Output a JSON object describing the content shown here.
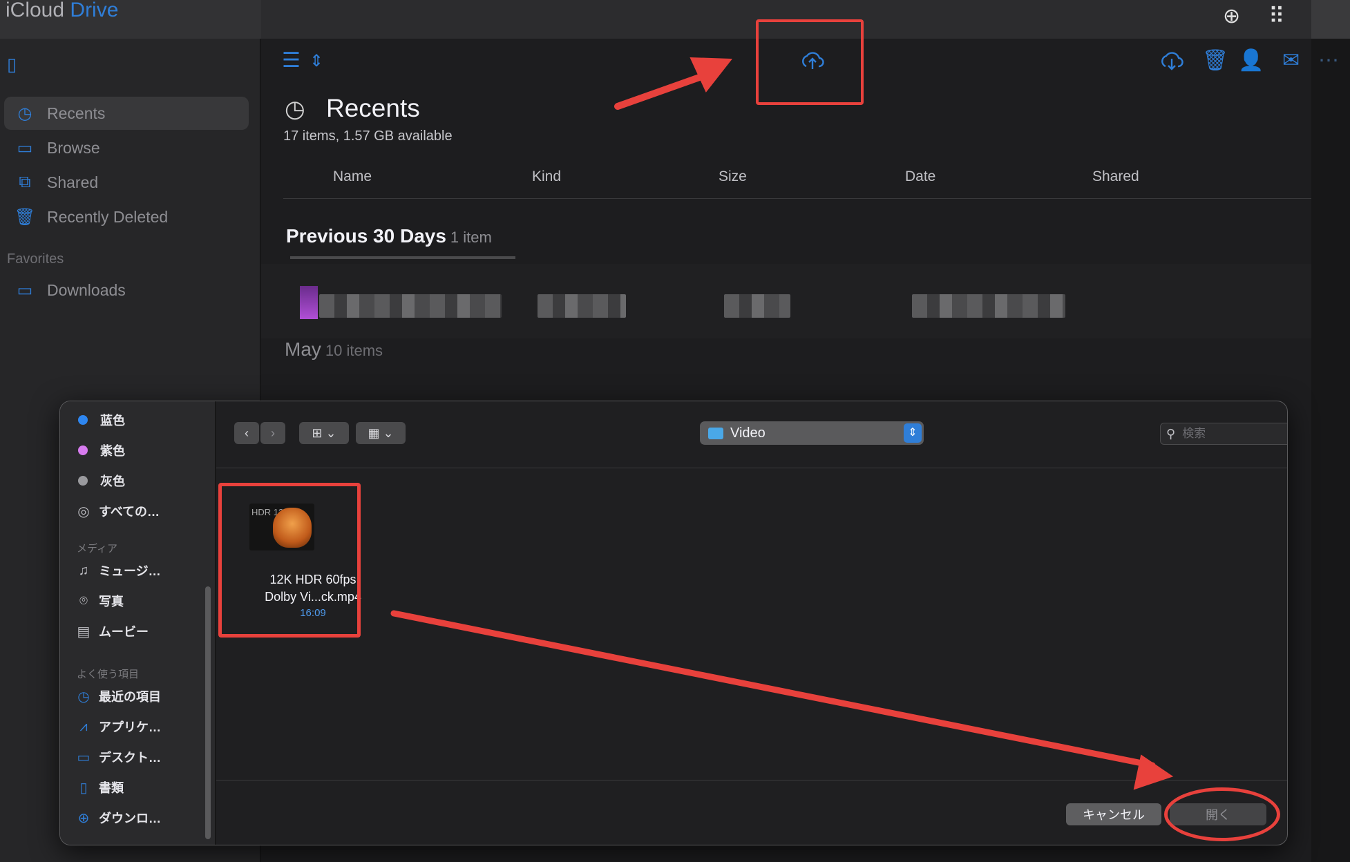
{
  "app": {
    "title_part1": "iCloud",
    "title_part2": "Drive"
  },
  "sidebar": {
    "items": [
      {
        "label": "Recents",
        "icon": "clock-icon"
      },
      {
        "label": "Browse",
        "icon": "folder-icon"
      },
      {
        "label": "Shared",
        "icon": "shared-folder-icon"
      },
      {
        "label": "Recently Deleted",
        "icon": "trash-icon"
      }
    ],
    "favorites_heading": "Favorites",
    "favorites": [
      {
        "label": "Downloads",
        "icon": "folder-icon"
      }
    ]
  },
  "main": {
    "title": "Recents",
    "subtitle": "17 items, 1.57 GB available",
    "columns": [
      "Name",
      "Kind",
      "Size",
      "Date",
      "Shared"
    ],
    "sections": [
      {
        "title": "Previous 30 Days",
        "count": "1 item"
      },
      {
        "title": "May",
        "count": "10 items"
      }
    ]
  },
  "dialog": {
    "tags": [
      {
        "label": "蓝色",
        "color": "#2e86f0"
      },
      {
        "label": "紫色",
        "color": "#d77bef"
      },
      {
        "label": "灰色",
        "color": "#9a9a9e"
      },
      {
        "label": "すべての…",
        "icon": "all-tags-icon"
      }
    ],
    "media_heading": "メディア",
    "media": [
      {
        "label": "ミュージ…",
        "icon": "music-note-icon"
      },
      {
        "label": "写真",
        "icon": "camera-icon"
      },
      {
        "label": "ムービー",
        "icon": "film-icon"
      }
    ],
    "favorites_heading": "よく使う項目",
    "favorites": [
      {
        "label": "最近の項目",
        "icon": "clock-icon"
      },
      {
        "label": "アプリケ…",
        "icon": "applications-icon"
      },
      {
        "label": "デスクト…",
        "icon": "desktop-icon"
      },
      {
        "label": "書類",
        "icon": "document-icon"
      },
      {
        "label": "ダウンロ…",
        "icon": "download-icon"
      }
    ],
    "folder": "Video",
    "search_placeholder": "検索",
    "file": {
      "name_line1": "12K HDR 60fps",
      "name_line2": "Dolby Vi...ck.mp4",
      "time": "16:09",
      "thumb_text": "HDR 12K"
    },
    "cancel_label": "キャンセル",
    "open_label": "開く"
  },
  "annotation_color": "#e8413c"
}
